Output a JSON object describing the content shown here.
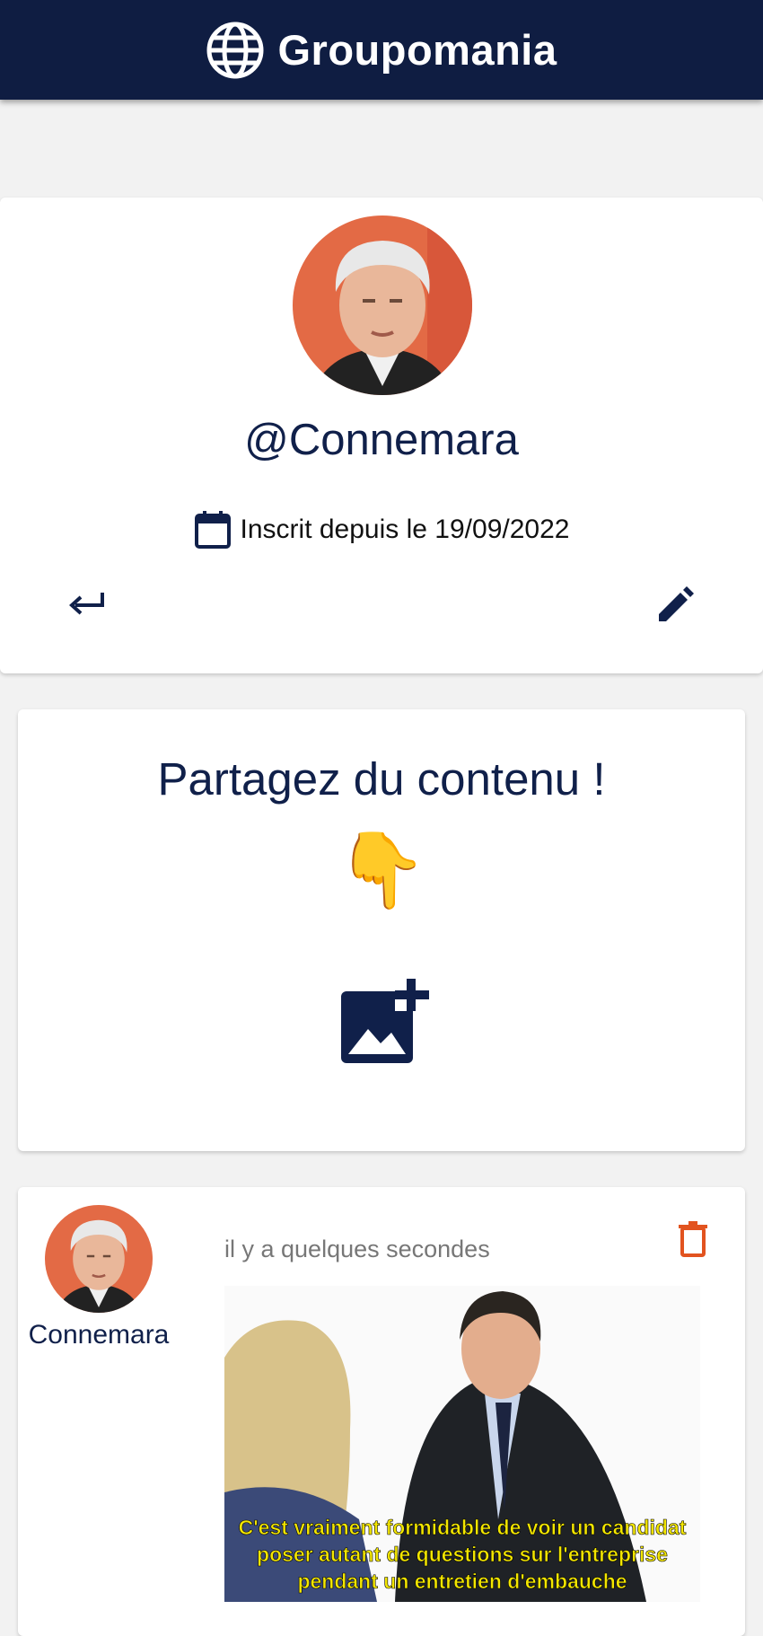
{
  "header": {
    "title": "Groupomania",
    "logo_icon": "globe-icon"
  },
  "profile": {
    "username": "@Connemara",
    "member_since": "Inscrit depuis le 19/09/2022",
    "calendar_icon": "calendar-icon",
    "back_icon": "return-arrow-icon",
    "edit_icon": "pencil-icon"
  },
  "share": {
    "title": "Partagez du contenu !",
    "pointer_emoji": "👇",
    "add_image_icon": "add-photo-icon"
  },
  "post": {
    "author": "Connemara",
    "timestamp": "il y a quelques secondes",
    "delete_icon": "trash-icon",
    "caption_lines": [
      "C'est vraiment formidable de voir un candidat",
      "poser autant de questions sur l'entreprise",
      "pendant un entretien d'embauche"
    ]
  },
  "colors": {
    "header_bg": "#0f1d42",
    "primary_text": "#10204a",
    "delete": "#e2531f",
    "background": "#f2f2f2"
  }
}
